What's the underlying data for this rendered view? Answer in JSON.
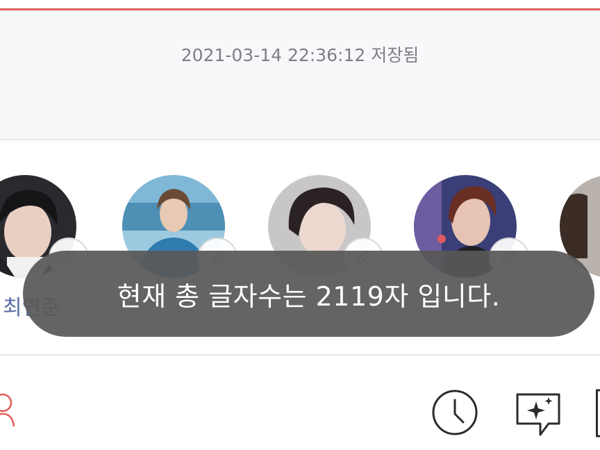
{
  "editor": {
    "saved_status": "2021-03-14 22:36:12 저장됨"
  },
  "characters": [
    {
      "name": "최연준",
      "avatar": "avatar-photo-1"
    },
    {
      "name": "",
      "avatar": "avatar-photo-2"
    },
    {
      "name": "",
      "avatar": "avatar-photo-3"
    },
    {
      "name": "",
      "avatar": "avatar-photo-4"
    }
  ],
  "toast": {
    "message": "현재 총 글자수는 2119자 입니다."
  },
  "toolbar": {
    "icons": [
      "person-icon",
      "clock-icon",
      "sparkle-chat-icon",
      "more-icon"
    ]
  },
  "colors": {
    "accent_line": "#e0605b",
    "name_text": "#5a6ea8",
    "toast_bg": "#585858",
    "icon_dark": "#2b2b2b",
    "icon_red": "#e0605b"
  }
}
